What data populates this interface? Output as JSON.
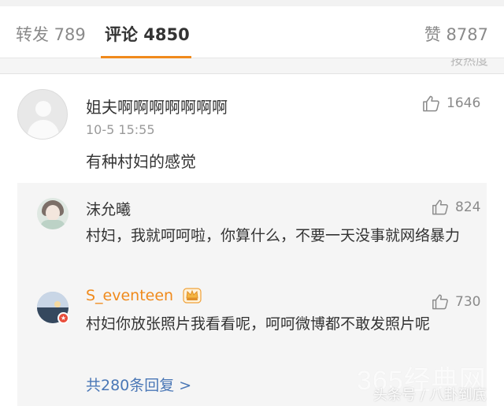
{
  "tabs": {
    "repost": "转发 789",
    "comment": "评论 4850",
    "like": "赞 8787",
    "peek_text": "按热度"
  },
  "comment": {
    "user": "姐夫啊啊啊啊啊啊啊",
    "time": "10-5 15:55",
    "text": "有种村妇的感觉",
    "likes": "1646"
  },
  "replies": [
    {
      "user": "沫允曦",
      "text": "村妇，我就呵呵啦，你算什么，不要一天没事就网络暴力",
      "likes": "824"
    },
    {
      "user": "S_eventeen",
      "text": "村妇你放张照片我看看呢，呵呵微博都不敢发照片呢",
      "likes": "730"
    }
  ],
  "more_replies": "共280条回复 >",
  "watermark": {
    "site": "365经典网",
    "source": "头条号 / 八卦到底"
  },
  "colors": {
    "accent": "#f08a1c",
    "link": "#4a77b6",
    "reply_bg": "#f5f5f5"
  }
}
